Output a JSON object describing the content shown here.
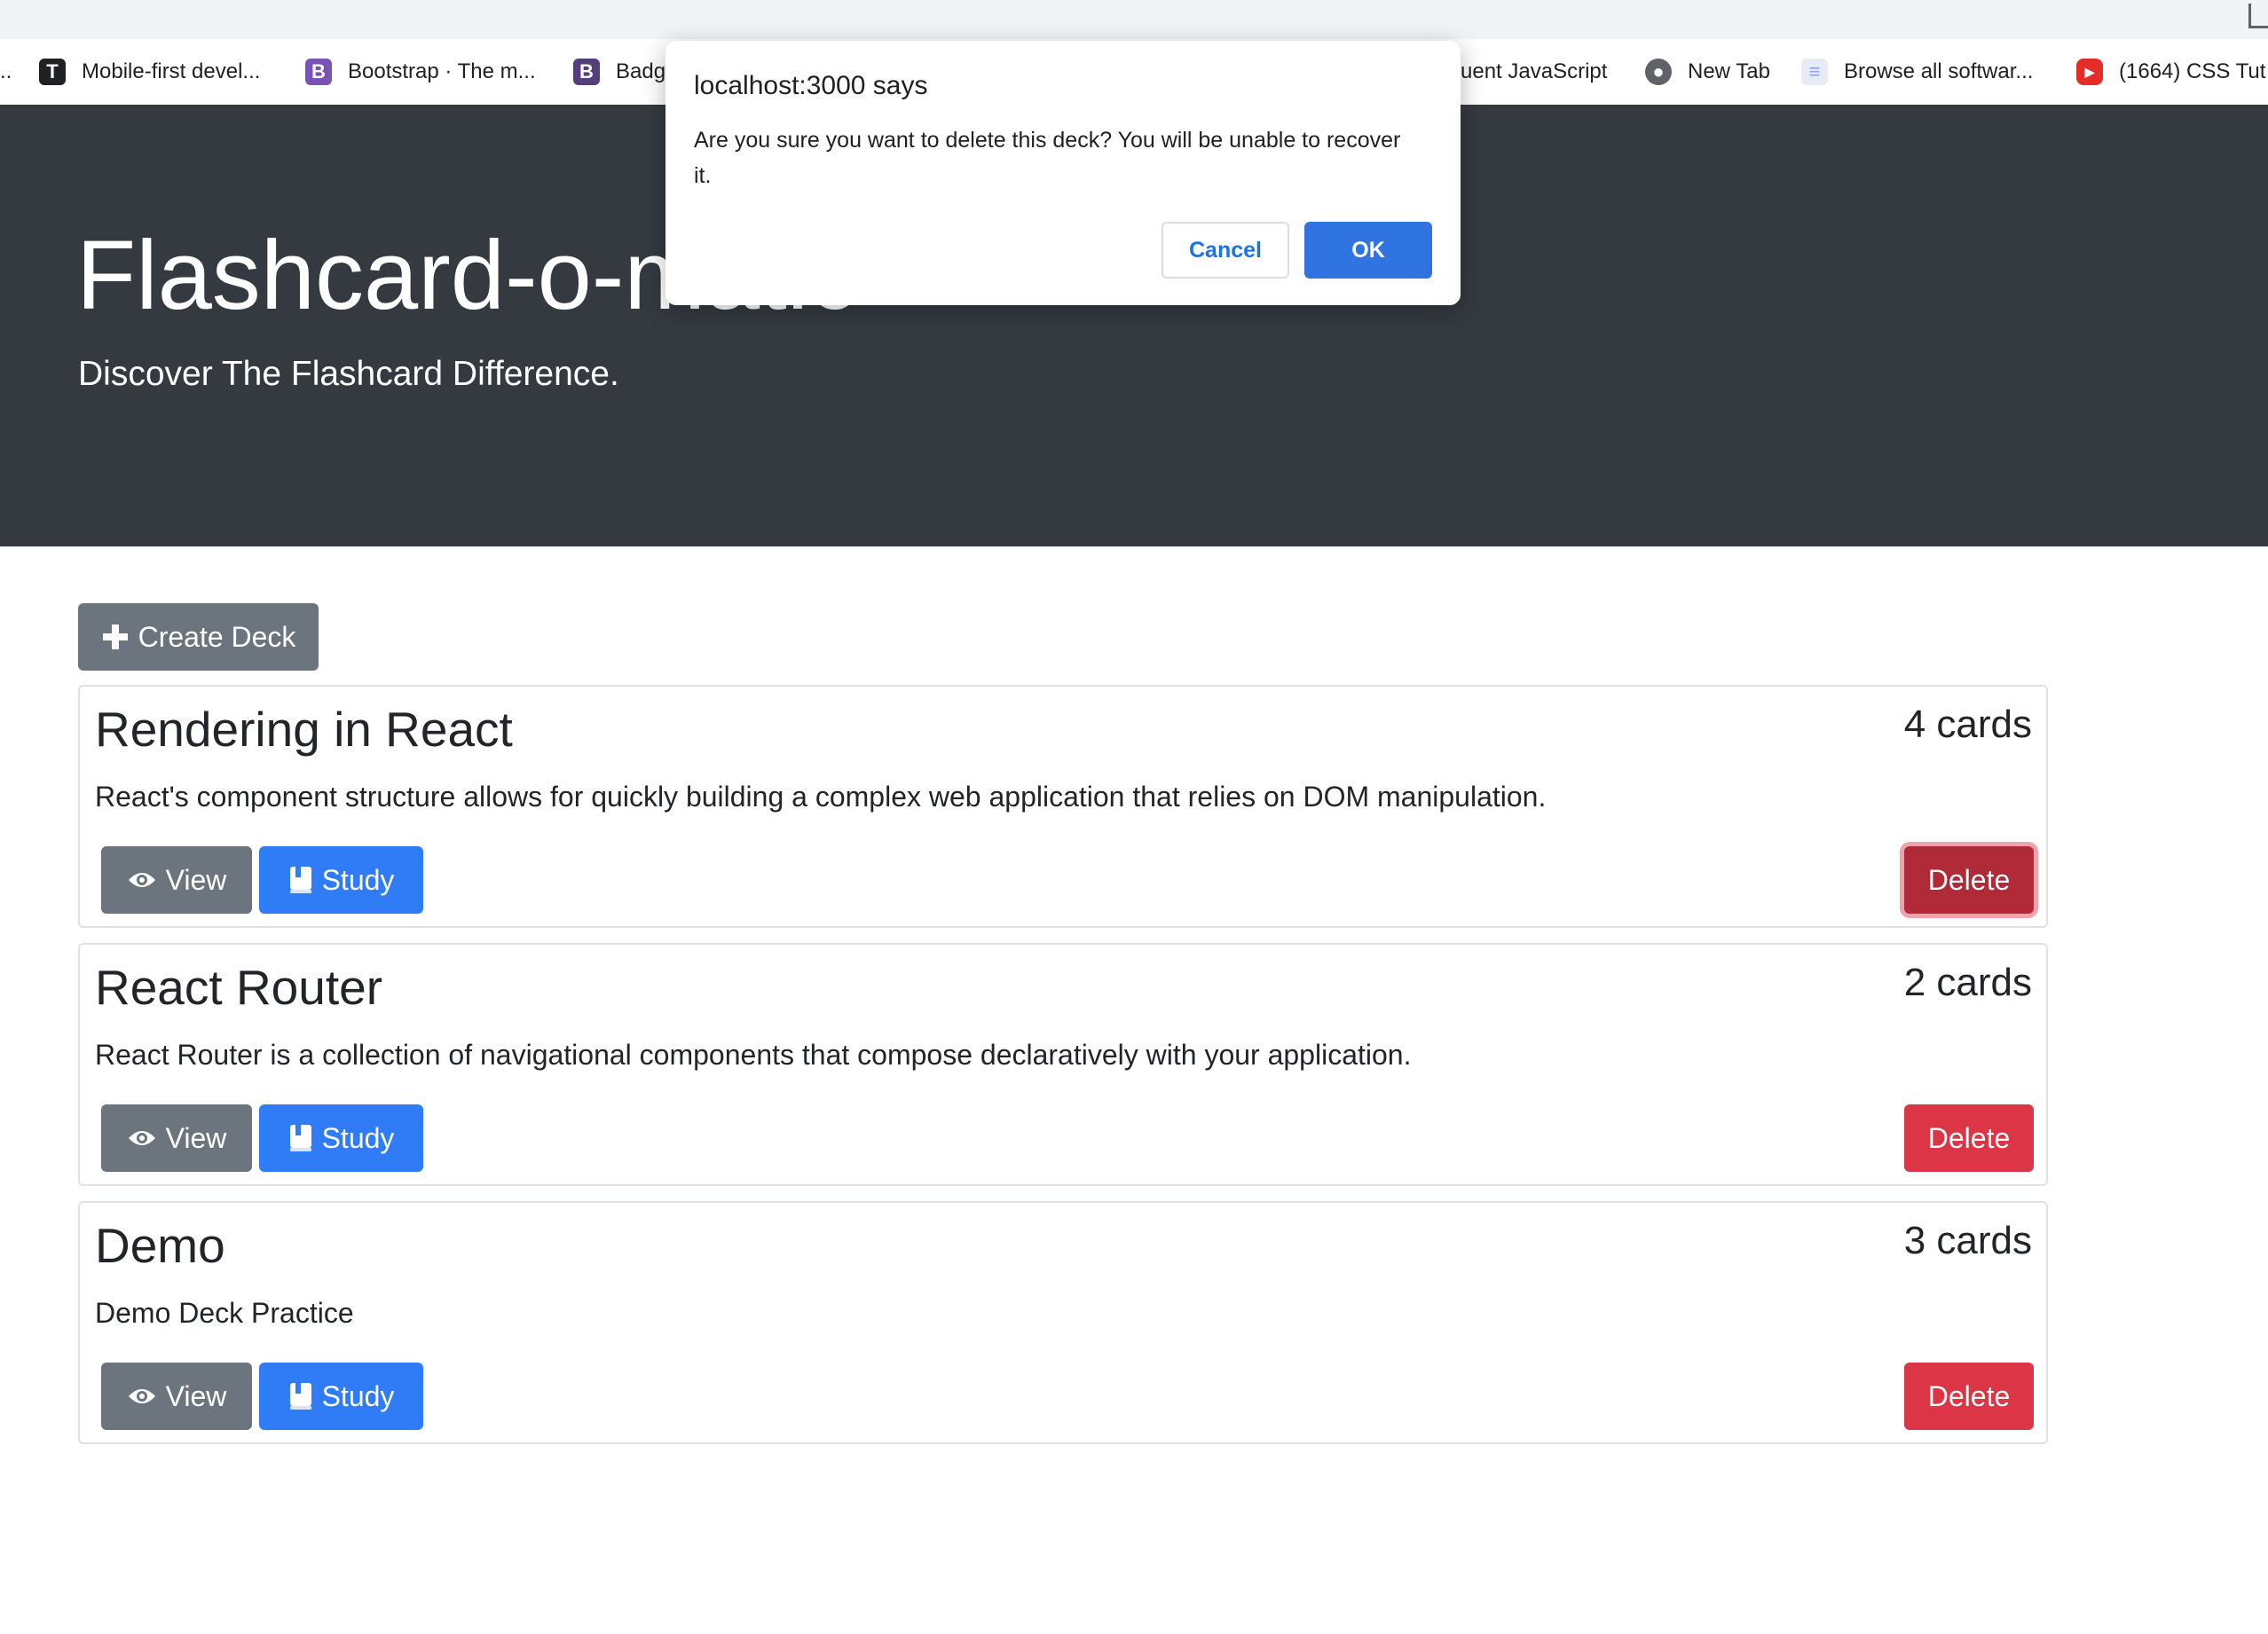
{
  "colors": {
    "hero_bg": "#343a40",
    "secondary": "#6c757d",
    "primary": "#2f7cf6",
    "danger": "#dc3545",
    "danger_active": "#b02a37",
    "dialog_accent": "#1a73e8"
  },
  "bookmarks": [
    {
      "label": "Mobile-first devel...",
      "icon": "tailwind-icon"
    },
    {
      "label": "Bootstrap · The m...",
      "icon": "bootstrap-icon"
    },
    {
      "label": "Badg",
      "icon": "bootstrap-dark-icon"
    },
    {
      "label": "uent JavaScript",
      "icon": ""
    },
    {
      "label": "New Tab",
      "icon": "globe-icon"
    },
    {
      "label": "Browse all softwar...",
      "icon": "software-icon"
    },
    {
      "label": "(1664) CSS Tut",
      "icon": "youtube-icon"
    }
  ],
  "hero": {
    "title": "Flashcard-o-matic",
    "subtitle": "Discover The Flashcard Difference."
  },
  "create_deck_label": "Create Deck",
  "decks": [
    {
      "name": "Rendering in React",
      "count": "4 cards",
      "description": "React's component structure allows for quickly building a complex web application that relies on DOM manipulation.",
      "view_label": "View",
      "study_label": "Study",
      "delete_label": "Delete"
    },
    {
      "name": "React Router",
      "count": "2 cards",
      "description": "React Router is a collection of navigational components that compose declaratively with your application.",
      "view_label": "View",
      "study_label": "Study",
      "delete_label": "Delete"
    },
    {
      "name": "Demo",
      "count": "3 cards",
      "description": "Demo Deck Practice",
      "view_label": "View",
      "study_label": "Study",
      "delete_label": "Delete"
    }
  ],
  "dialog": {
    "title": "localhost:3000 says",
    "message": "Are you sure you want to delete this deck? You will be unable to recover it.",
    "cancel_label": "Cancel",
    "ok_label": "OK"
  }
}
